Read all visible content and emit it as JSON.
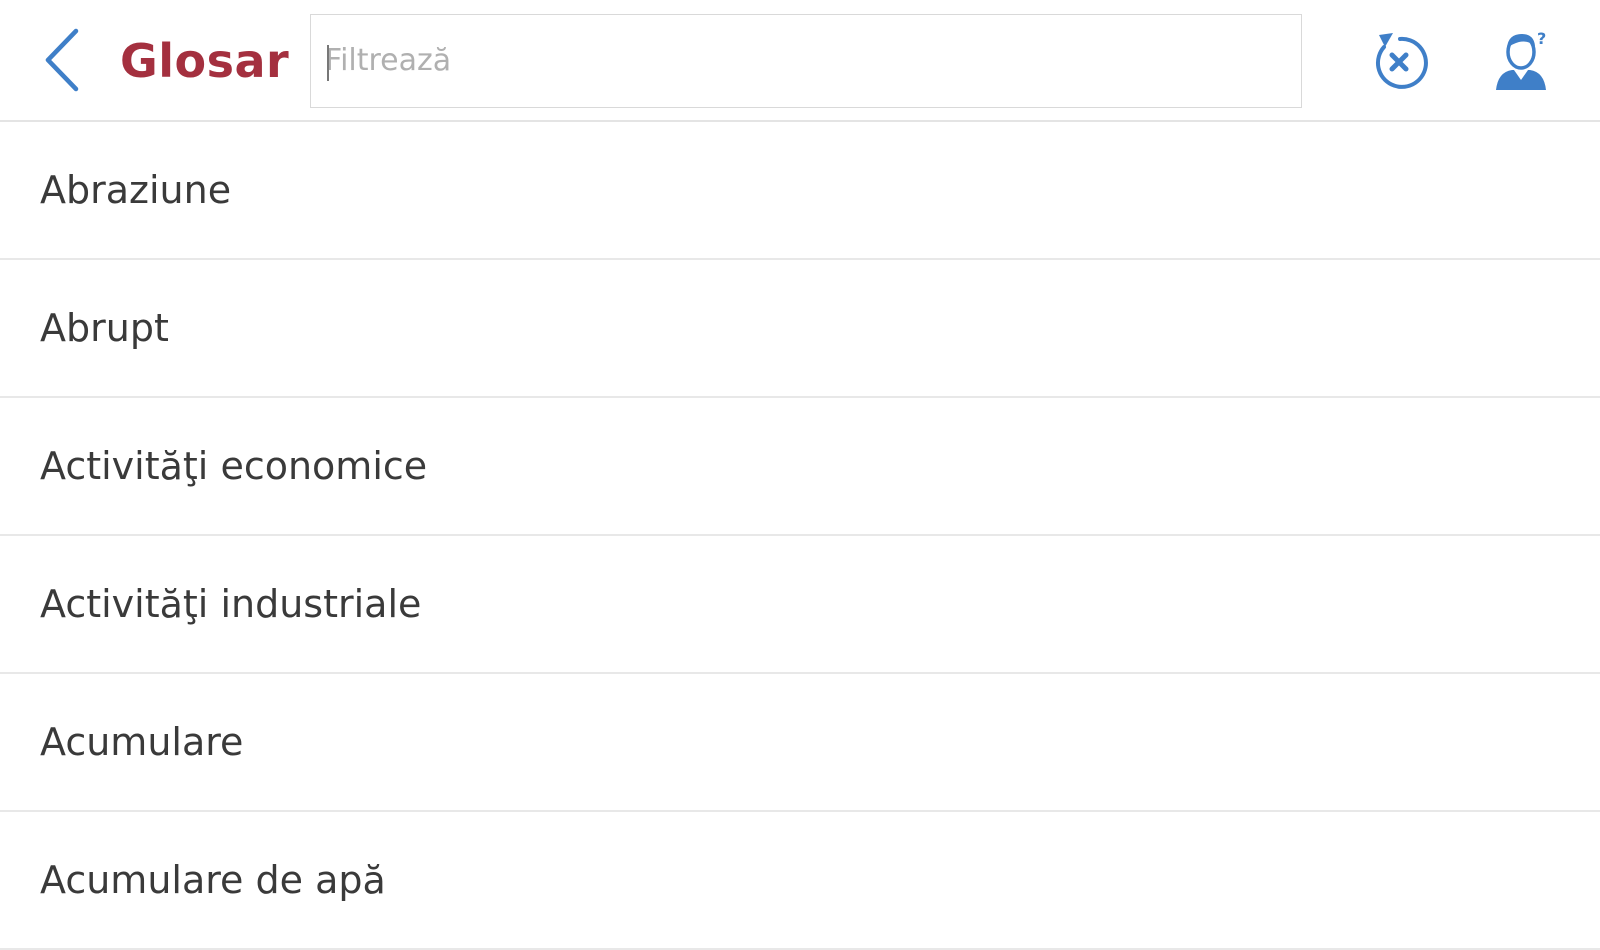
{
  "header": {
    "title": "Glosar",
    "back_icon": "chevron-left-icon",
    "search": {
      "value": "",
      "placeholder": "Filtrează"
    },
    "reset_icon": "reset-close-icon",
    "help_icon": "user-help-icon"
  },
  "colors": {
    "title": "#a4303f",
    "icon_blue": "#3f7fc8",
    "text": "#3a3a3a",
    "divider": "#e8e8e8"
  },
  "glossary": {
    "items": [
      {
        "label": "Abraziune"
      },
      {
        "label": "Abrupt"
      },
      {
        "label": "Activităţi economice"
      },
      {
        "label": "Activităţi industriale"
      },
      {
        "label": "Acumulare"
      },
      {
        "label": "Acumulare de apă"
      }
    ]
  }
}
